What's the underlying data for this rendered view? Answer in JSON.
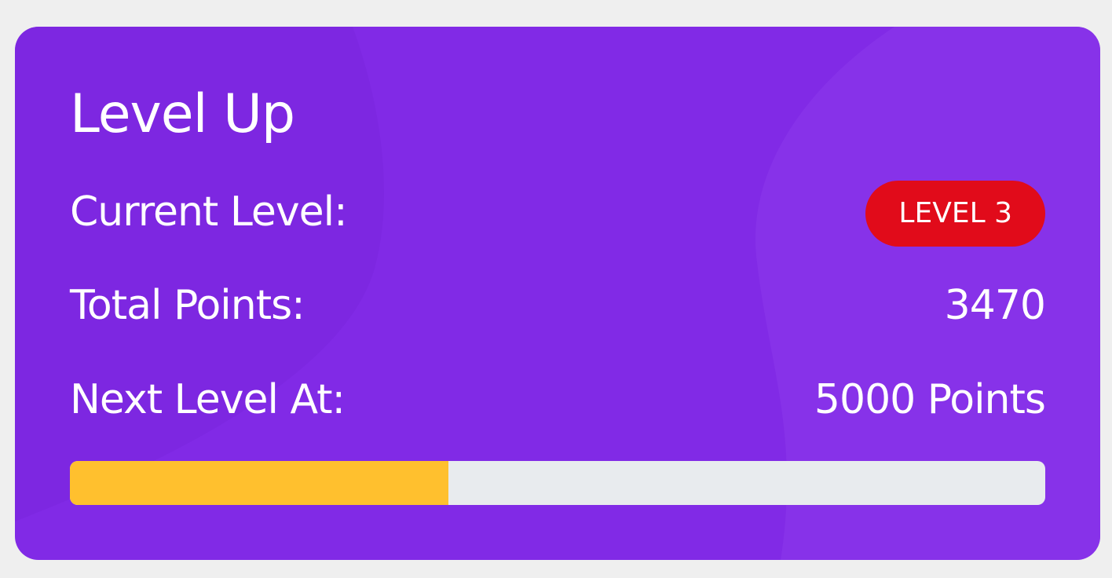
{
  "card": {
    "title": "Level Up",
    "current_level_label": "Current Level:",
    "level_badge": "LEVEL 3",
    "total_points_label": "Total Points:",
    "total_points_value": "3470",
    "next_level_label": "Next Level At:",
    "next_level_value": "5000 Points",
    "progress": {
      "fraction": 0.388
    }
  },
  "colors": {
    "background": "#efefef",
    "card": "#812ae6",
    "badge": "#e10b1a",
    "progress_fill": "#ffc02e",
    "progress_track": "#e8ebee",
    "text": "#ffffff"
  }
}
